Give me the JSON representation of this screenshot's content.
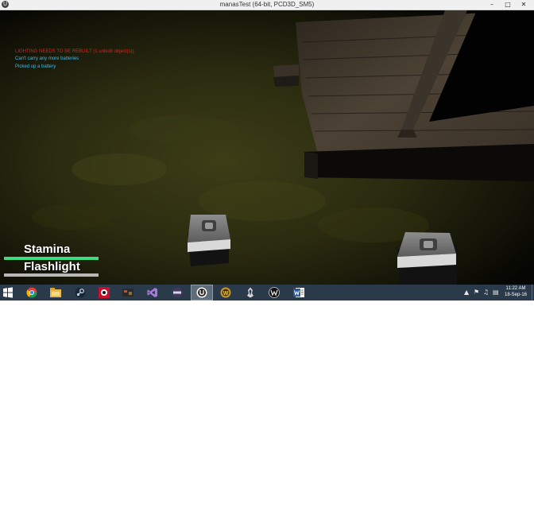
{
  "window": {
    "title": "manasTest (64-bit, PCD3D_SM5)",
    "controls": {
      "minimize": "–",
      "maximize": "□",
      "close": "✕"
    },
    "app_icon": "unreal-engine-icon"
  },
  "log": {
    "warning": "LIGHTING NEEDS TO BE REBUILT (1 unbuilt object(s))",
    "messages": [
      "Can't carry any more batteries",
      "Picked up a battery"
    ],
    "colors": {
      "warning": "#e02020",
      "info": "#3fb9e6"
    }
  },
  "hud": {
    "stamina": {
      "label": "Stamina",
      "level": 1.0,
      "color": "#3ddc84"
    },
    "flashlight": {
      "label": "Flashlight",
      "level": 1.0,
      "color": "#b8b8b8"
    }
  },
  "taskbar": {
    "start_icon": "windows-logo-icon",
    "apps": [
      {
        "name": "chrome-icon",
        "active": false
      },
      {
        "name": "file-explorer-icon",
        "active": false
      },
      {
        "name": "steam-icon",
        "active": false
      },
      {
        "name": "red-app-icon",
        "active": false
      },
      {
        "name": "game-app-icon",
        "active": false
      },
      {
        "name": "visual-studio-icon",
        "active": false
      },
      {
        "name": "circle-app-icon",
        "active": false
      },
      {
        "name": "unreal-engine-icon",
        "active": true
      },
      {
        "name": "warcraft-icon",
        "active": false
      },
      {
        "name": "skyrim-icon",
        "active": false
      },
      {
        "name": "witcher-icon",
        "active": false
      },
      {
        "name": "word-icon",
        "active": false
      }
    ],
    "tray_icons": [
      "chevron-up-icon",
      "flag-icon",
      "volume-icon",
      "network-icon",
      "keyboard-icon"
    ],
    "clock": {
      "time": "11:22 AM",
      "date": "18-Sep-16"
    }
  }
}
